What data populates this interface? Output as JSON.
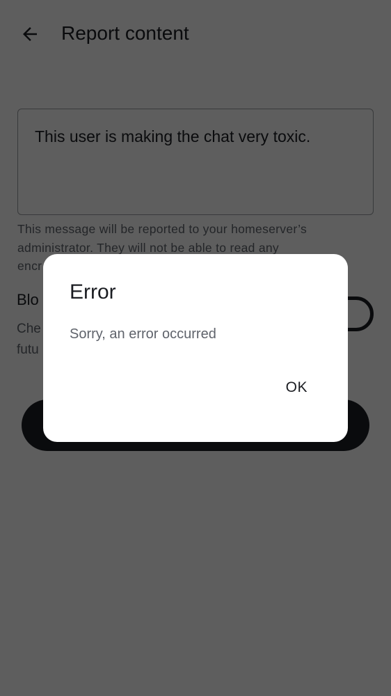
{
  "header": {
    "title": "Report content",
    "back_icon": "arrow-left-icon"
  },
  "form": {
    "reason_value": "This user is making the chat very toxic.",
    "hint_lines": [
      "This message will be reported to your homeserver’s",
      "administrator. They will not be able to read any",
      "encr"
    ],
    "block_label_fragment": "Blo",
    "block_desc_fragments": [
      "Che",
      "futu"
    ]
  },
  "dialog": {
    "title": "Error",
    "message": "Sorry, an error occurred",
    "ok_label": "OK"
  }
}
